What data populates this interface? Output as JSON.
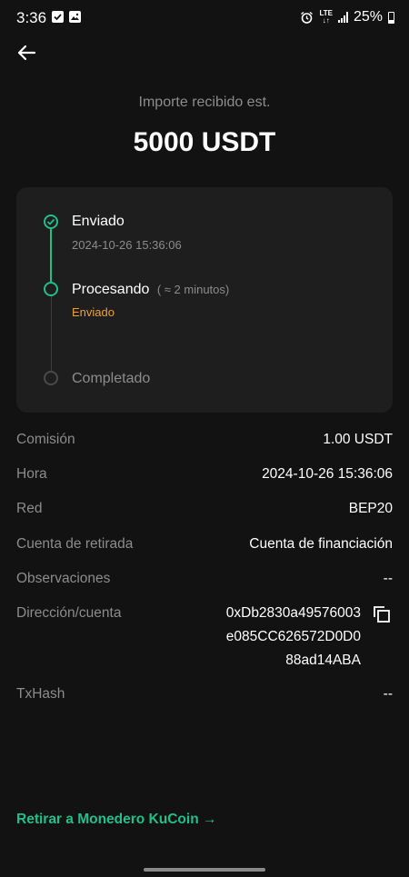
{
  "status_bar": {
    "time": "3:36",
    "network": "LTE",
    "battery": "25%",
    "icons": [
      "checkbox-icon",
      "image-icon",
      "alarm-icon",
      "lte-icon",
      "signal-icon",
      "battery-icon"
    ]
  },
  "header": {
    "back_icon": "arrow-left-icon"
  },
  "summary": {
    "label": "Importe recibido est.",
    "amount": "5000 USDT"
  },
  "progress": {
    "steps": [
      {
        "title": "Enviado",
        "subtitle": "2024-10-26 15:36:06",
        "state": "done"
      },
      {
        "title": "Procesando",
        "hint": "( ≈ 2 minutos)",
        "subtitle": "Enviado",
        "state": "active"
      },
      {
        "title": "Completado",
        "state": "pending"
      }
    ]
  },
  "details": {
    "fee_label": "Comisión",
    "fee_value": "1.00 USDT",
    "time_label": "Hora",
    "time_value": "2024-10-26 15:36:06",
    "network_label": "Red",
    "network_value": "BEP20",
    "account_label": "Cuenta de retirada",
    "account_value": "Cuenta de financiación",
    "remarks_label": "Observaciones",
    "remarks_value": "--",
    "address_label": "Dirección/cuenta",
    "address_lines": [
      "0xDb2830a49576003",
      "e085CC626572D0D0",
      "88ad14ABA"
    ],
    "txhash_label": "TxHash",
    "txhash_value": "--"
  },
  "footer": {
    "link": "Retirar a Monedero KuCoin →"
  },
  "colors": {
    "background": "#121212",
    "card": "#1e1e1e",
    "accent_green": "#1fbf8c",
    "accent_orange": "#f0a030",
    "muted_text": "#8c8c8c"
  }
}
